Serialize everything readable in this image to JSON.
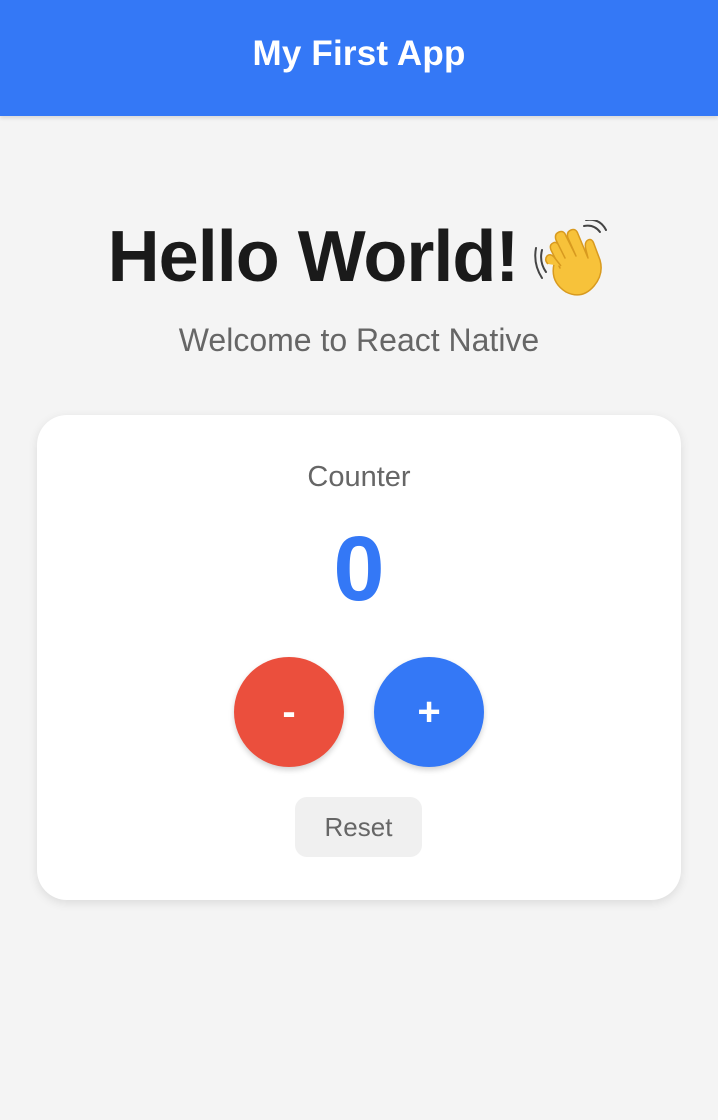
{
  "header": {
    "title": "My First App"
  },
  "hero": {
    "title": "Hello World!",
    "icon": "waving-hand-icon",
    "subtitle": "Welcome to React Native"
  },
  "counter": {
    "label": "Counter",
    "value": "0",
    "decrement_label": "-",
    "increment_label": "+",
    "reset_label": "Reset"
  },
  "colors": {
    "primary": "#3478f6",
    "danger": "#eb4f3d",
    "background": "#f4f4f4",
    "card": "#ffffff",
    "muted_text": "#666666",
    "title_text": "#1a1a1a"
  }
}
